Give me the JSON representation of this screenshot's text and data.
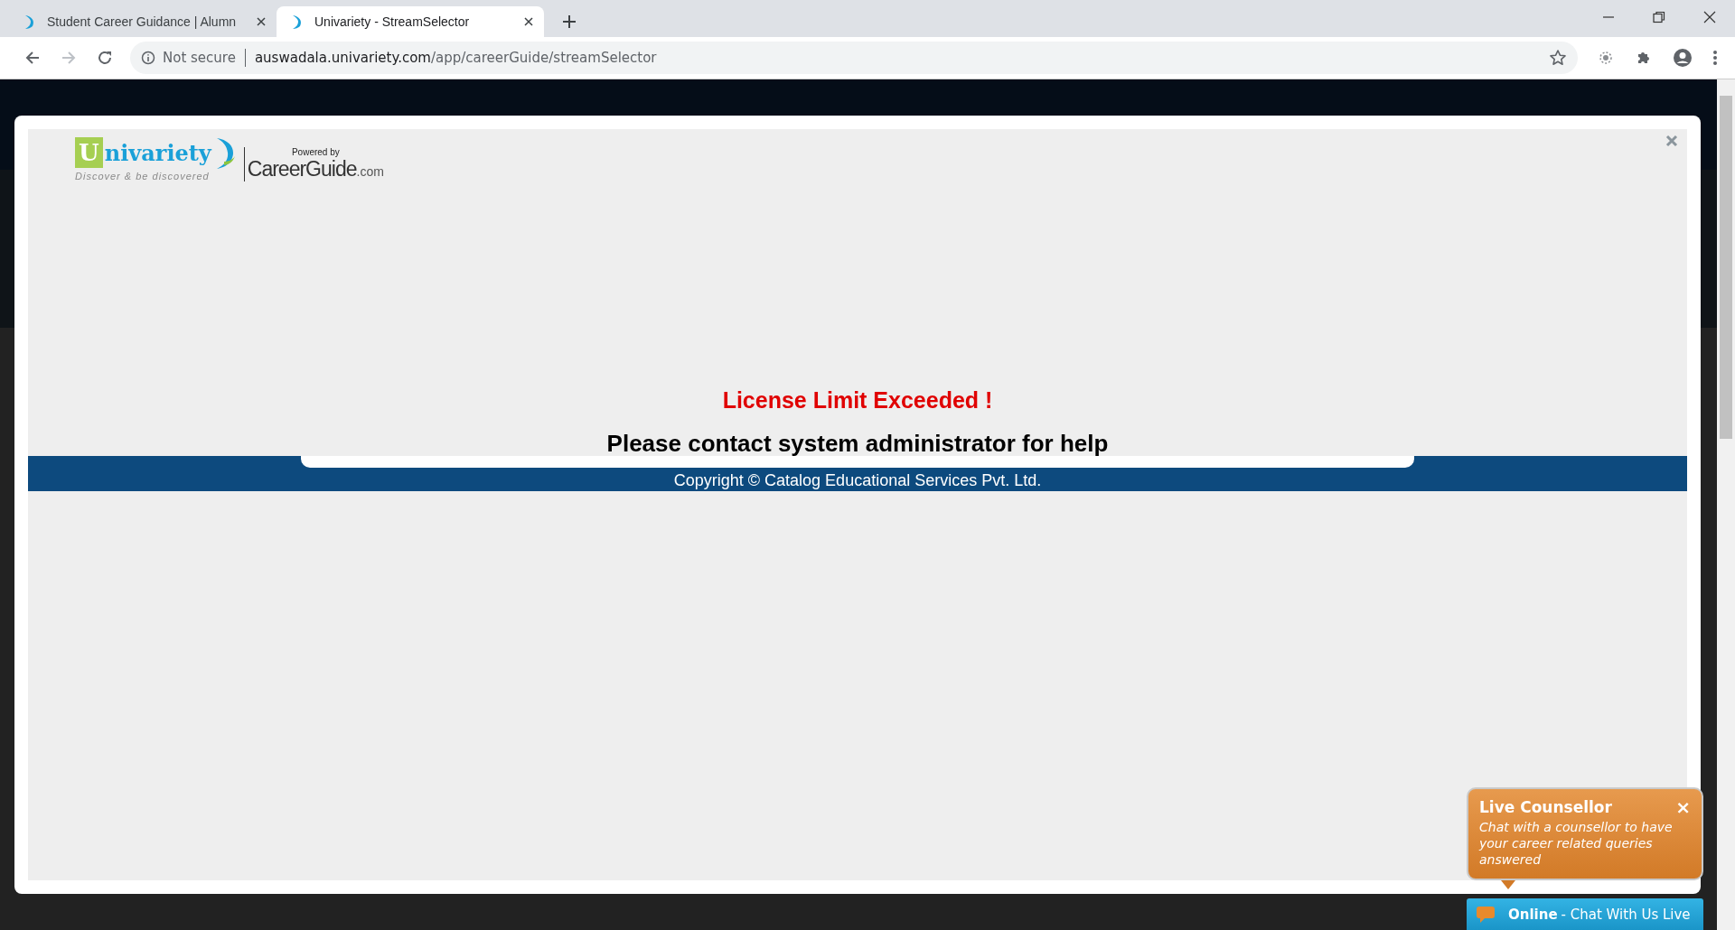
{
  "browser": {
    "tabs": [
      {
        "title": "Student Career Guidance | Alumn",
        "selected": false
      },
      {
        "title": "Univariety - StreamSelector",
        "selected": true
      }
    ],
    "address": {
      "security": "Not secure",
      "host": "auswadala.univariety.com",
      "path": "/app/careerGuide/streamSelector"
    }
  },
  "modal": {
    "logo": {
      "initial": "U",
      "name": "nivariety",
      "tagline": "Discover & be discovered",
      "powered_by": "Powered by",
      "partner": "CareerGuide",
      "partner_suffix": ".com"
    },
    "message": {
      "title": "License Limit Exceeded !",
      "body": "Please contact system administrator for help"
    },
    "footer": "Copyright © Catalog Educational Services Pvt. Ltd."
  },
  "chat": {
    "popup": {
      "title": "Live Counsellor",
      "close": "×",
      "text": "Chat with a counsellor to have your career related queries answered"
    },
    "bar": {
      "status": "Online",
      "label": "- Chat With Us Live"
    }
  }
}
